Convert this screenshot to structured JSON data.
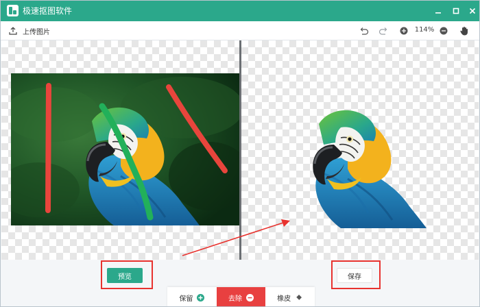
{
  "app": {
    "title": "极速抠图软件"
  },
  "toolbar": {
    "upload_label": "上传图片",
    "zoom_level": "114%"
  },
  "actions": {
    "preview_label": "预览",
    "save_label": "保存"
  },
  "tools": [
    {
      "label": "保留",
      "icon": "plus-circle-icon"
    },
    {
      "label": "去除",
      "icon": "minus-circle-icon"
    },
    {
      "label": "橡皮",
      "icon": "eraser-icon"
    }
  ],
  "colors": {
    "accent": "#2ba88b",
    "remove": "#e84040",
    "keep_stroke": "#22b05a",
    "remove_stroke": "#e8453c",
    "highlight": "#e8322e"
  },
  "icons": {
    "upload": "upload-icon",
    "undo": "undo-icon",
    "redo": "redo-icon",
    "zoom_in": "zoom-in-icon",
    "zoom_out": "zoom-out-icon",
    "hand": "hand-icon"
  }
}
